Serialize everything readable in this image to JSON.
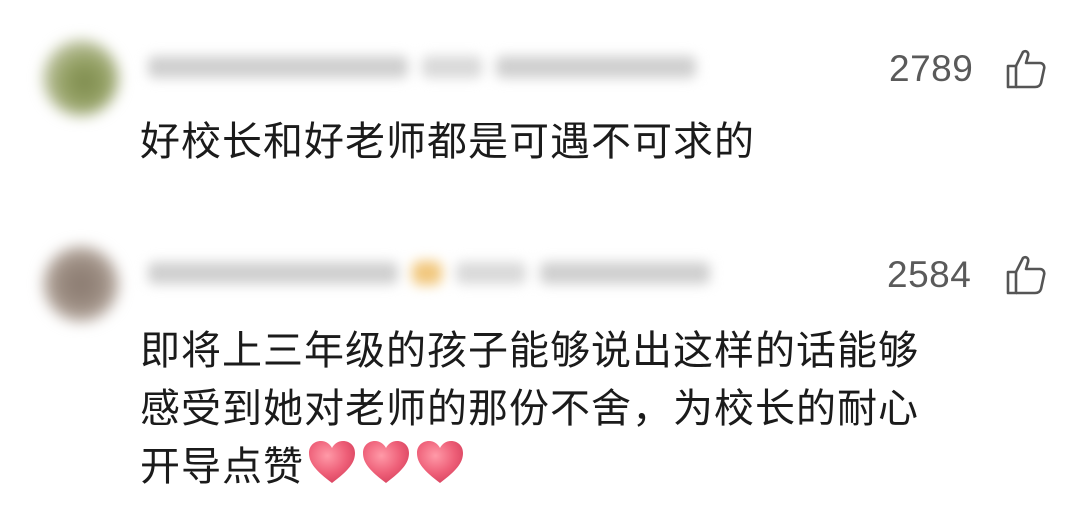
{
  "comments": [
    {
      "like_count": "2789",
      "text_lines": [
        "好校长和好老师都是可遇不可求的"
      ]
    },
    {
      "like_count": "2584",
      "text_lines": [
        "即将上三年级的孩子能够说出这样的话能够",
        "感受到她对老师的那份不舍，为校长的耐心",
        "开导点赞"
      ],
      "trailing_icons": [
        "heart-icon",
        "heart-icon",
        "heart-icon"
      ]
    }
  ],
  "colors": {
    "like_count": "#5a5a5a",
    "text": "#1b1b1b",
    "heart": "#e8556f"
  }
}
